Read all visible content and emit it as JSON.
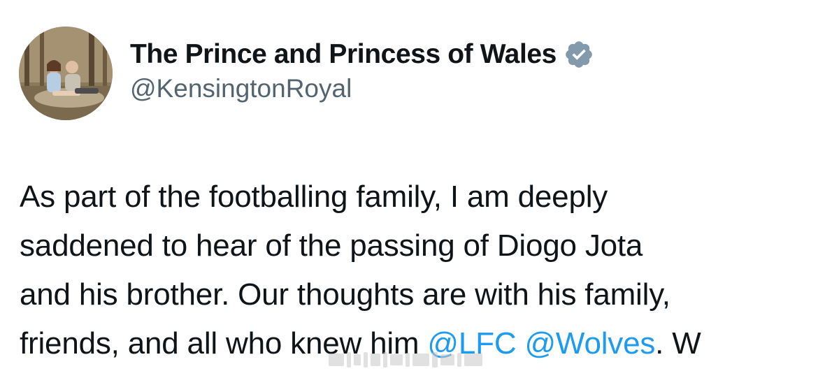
{
  "account": {
    "display_name": "The Prince and Princess of Wales",
    "handle": "@KensingtonRoyal",
    "verified": true,
    "verified_badge_color": "#829aab"
  },
  "tweet": {
    "line1": "As part of the footballing family, I am deeply",
    "line2": "saddened to hear of the passing of Diogo Jota",
    "line3": "and his brother. Our thoughts are with his family,",
    "line4_text": "friends, and all who knew him ",
    "mention1": "@LFC",
    "mention_space": " ",
    "mention2": "@Wolves",
    "line4_tail": ". W"
  },
  "colors": {
    "text": "#0f1419",
    "secondary": "#536471",
    "link": "#1d9bf0"
  },
  "icons": {
    "avatar": "profile-photo",
    "badge": "verified-badge-icon"
  }
}
